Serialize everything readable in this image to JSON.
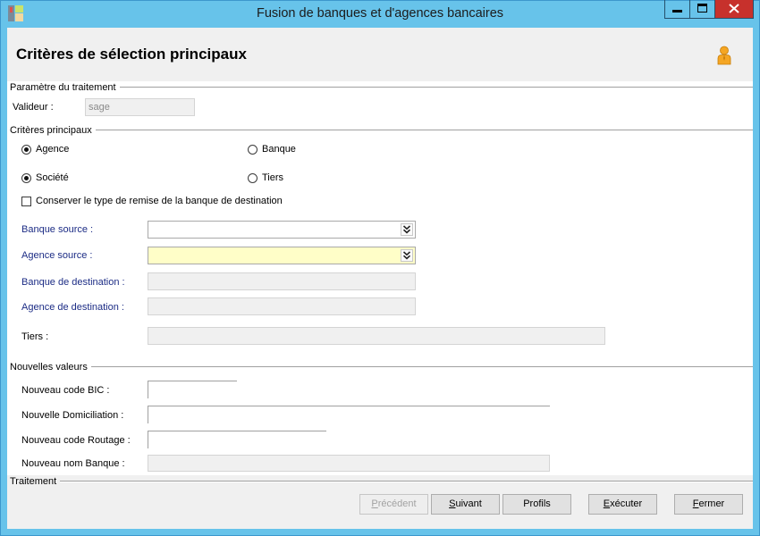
{
  "colors": {
    "frame": "#67c3ea",
    "close": "#c7312c",
    "label_blue": "#1c2c85",
    "highlight_field": "#fffec8",
    "disabled_field": "#f0f0f0"
  },
  "icons": {
    "app": "app-icon",
    "user": "user-icon",
    "dropdown": "double-chevron-down-icon",
    "minimize": "minimize-icon",
    "maximize": "maximize-icon",
    "close": "close-icon"
  },
  "window": {
    "title": "Fusion de banques et d'agences bancaires"
  },
  "header": {
    "title": "Critères de sélection principaux"
  },
  "parametre": {
    "label": "Paramètre du traitement",
    "valideur": {
      "label": "Valideur :",
      "value": "sage"
    }
  },
  "criteres": {
    "label": "Critères principaux",
    "radios": [
      {
        "label": "Agence",
        "checked": true
      },
      {
        "label": "Banque",
        "checked": false
      },
      {
        "label": "Société",
        "checked": true
      },
      {
        "label": "Tiers",
        "checked": false
      }
    ],
    "conserver": {
      "label": "Conserver le type de remise de la banque de destination",
      "checked": false
    },
    "banque_source": {
      "label": "Banque source :",
      "value": ""
    },
    "agence_source": {
      "label": "Agence source :",
      "value": ""
    },
    "banque_destination": {
      "label": "Banque de destination :",
      "value": ""
    },
    "agence_destination": {
      "label": "Agence de destination :",
      "value": ""
    },
    "tiers": {
      "label": "Tiers :",
      "value": ""
    }
  },
  "nouvelles_valeurs": {
    "label": "Nouvelles valeurs",
    "code_bic": {
      "label": "Nouveau code BIC :",
      "value": ""
    },
    "domiciliation": {
      "label": "Nouvelle Domiciliation :",
      "value": ""
    },
    "code_routage": {
      "label": "Nouveau code Routage :",
      "value": ""
    },
    "nom_banque": {
      "label": "Nouveau nom Banque :",
      "value": ""
    }
  },
  "traitement": {
    "label": "Traitement",
    "buttons": [
      {
        "label": "Précédent",
        "disabled": true
      },
      {
        "label": "Suivant",
        "disabled": false
      },
      {
        "label": "Profils",
        "disabled": false
      },
      {
        "label": "Exécuter",
        "disabled": false
      },
      {
        "label": "Fermer",
        "disabled": false
      }
    ]
  }
}
